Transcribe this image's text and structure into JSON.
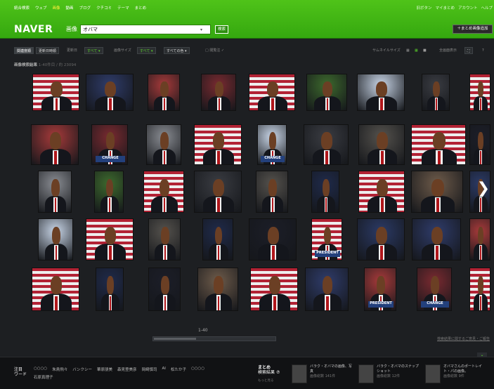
{
  "global_nav": {
    "items": [
      "統合検索",
      "ウェブ",
      "画像",
      "動画",
      "ブログ",
      "クチコミ",
      "テーマ",
      "まとめ"
    ],
    "active": "画像"
  },
  "user_nav": {
    "items": [
      "旧ボタン",
      "マイまとめ",
      "アカウント",
      "ヘルプ"
    ]
  },
  "header": {
    "logo": "NAVER",
    "category": "画像",
    "search_value": "オバマ",
    "search_button": "検索",
    "add_button": "＋まとめ画像追加"
  },
  "filters": {
    "related": "関連度順",
    "updated": "更新日時順",
    "update_label": "更新日",
    "update_value": "すべて ▾",
    "size_label": "画像サイズ",
    "size_value": "すべて ▾",
    "color_value": "すべての色 ▾",
    "rating": "□ 閲覧注 ✓",
    "thumb_label": "サムネイルサイズ",
    "fullscreen": "全画面表示"
  },
  "results": {
    "label": "画像検索結果",
    "range": "1-40件目 / 約 23094"
  },
  "grid": {
    "signs": [
      "CHANGE",
      "CHANGE",
      "PRESIDENT",
      "PRESIDENT",
      "CHANGE"
    ]
  },
  "pagination": {
    "range": "1-40",
    "report": "検索結果に関するご意見・ご報告"
  },
  "bottom": {
    "hot_words_label": "注目\nワード",
    "keywords": [
      "○○○○",
      "朱鳥飛々",
      "バンクシー",
      "華原朋美",
      "森見登美彦",
      "岡崎慎司",
      "AI",
      "松たか子",
      "○○○○"
    ],
    "keywords2": "石原真理子",
    "matome_title": "まとめ",
    "matome_sub": "検索結果 ℗",
    "matome_link": "もっと見る",
    "matome_items": [
      {
        "title": "バラク・オバマの画像、写真",
        "count": "画像総数 141件"
      },
      {
        "title": "バラク・オバマのスナップショット",
        "count": "画像総数 12件"
      },
      {
        "title": "オバマさんのポートレイト・パの画像。",
        "count": "画像総数 9件"
      }
    ]
  },
  "colors": {
    "header_green": "#3fb516",
    "accent_green": "#5ad32a",
    "background": "#1d1f22"
  }
}
